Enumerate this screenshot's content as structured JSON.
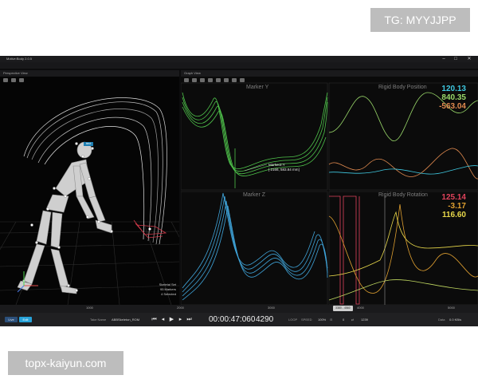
{
  "watermarks": {
    "top": "TG: MYYJJPP",
    "bottom": "topx-kaiyun.com"
  },
  "app": {
    "title": "Motive:Body 2.0.5",
    "menu": [
      "File",
      "Edit",
      "View",
      "Layout",
      "Tools",
      "Community",
      "Help"
    ],
    "window_controls": [
      "–",
      "□",
      "✕"
    ]
  },
  "perspective": {
    "title": "Perspective View",
    "label_tag": "bind",
    "info": [
      "Skeletal Set",
      "95 Markers",
      "4 Selected"
    ]
  },
  "graph": {
    "title": "Graph View",
    "layout_label": "Mo Custom Graph",
    "panes": {
      "marker_y": {
        "label": "Marker Y",
        "color": "#4fc34b"
      },
      "marker_z": {
        "label": "Marker Z",
        "color": "#3fa3d8"
      },
      "rb_position": {
        "label": "Rigid Body Position",
        "values": [
          "120.13",
          "840.35",
          "-563.04"
        ],
        "colors": [
          "#3fc8e0",
          "#9ad96a",
          "#e08a4f"
        ]
      },
      "rb_rotation": {
        "label": "Rigid Body Rotation",
        "values": [
          "125.14",
          "-3.17",
          "116.60"
        ],
        "colors": [
          "#e0435c",
          "#e0a030",
          "#e8d84a"
        ]
      }
    },
    "tooltip": [
      "Marker2:Y",
      "[ 2166, 583.84 mm]"
    ]
  },
  "timeline": {
    "ticks": [
      "1000",
      "2000",
      "3000",
      "4000",
      "5000"
    ],
    "range_marker": "3380 - 4560"
  },
  "transport": {
    "mode_live": "Live",
    "mode_edit": "Edit",
    "take_label": "Take Name",
    "take_name": "ABBSkeleton_ROM",
    "timecode": "00:00:47:060",
    "frame": "4290",
    "loop_label": "LOOP",
    "speed_label": "SPEED",
    "speed": "100%",
    "range_start": "0",
    "range_end": "1239",
    "data_label": "Data",
    "data_rate": "0.0 KB/s"
  }
}
